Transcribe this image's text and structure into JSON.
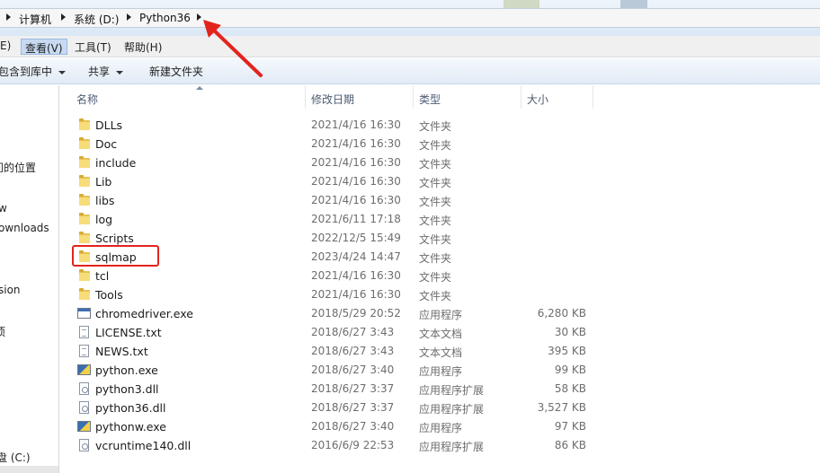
{
  "address_bar": {
    "breadcrumbs": [
      "计算机",
      "系统 (D:)",
      "Python36"
    ]
  },
  "menu": {
    "items": [
      "E)",
      "查看(V)",
      "工具(T)",
      "帮助(H)"
    ],
    "active_index": 1
  },
  "toolbar": {
    "include_library": "包含到库中",
    "share": "共享",
    "new_folder": "新建文件夹"
  },
  "nav": {
    "items": [
      "问的位置",
      "w",
      "ownloads",
      "sion",
      "项",
      "盘 (C:)"
    ]
  },
  "columns": {
    "name": "名称",
    "modified": "修改日期",
    "type": "类型",
    "size": "大小"
  },
  "files": [
    {
      "name": "DLLs",
      "date": "2021/4/16 16:30",
      "type": "文件夹",
      "size": "",
      "icon": "folder-icon"
    },
    {
      "name": "Doc",
      "date": "2021/4/16 16:30",
      "type": "文件夹",
      "size": "",
      "icon": "folder-icon"
    },
    {
      "name": "include",
      "date": "2021/4/16 16:30",
      "type": "文件夹",
      "size": "",
      "icon": "folder-icon"
    },
    {
      "name": "Lib",
      "date": "2021/4/16 16:30",
      "type": "文件夹",
      "size": "",
      "icon": "folder-icon"
    },
    {
      "name": "libs",
      "date": "2021/4/16 16:30",
      "type": "文件夹",
      "size": "",
      "icon": "folder-icon"
    },
    {
      "name": "log",
      "date": "2021/6/11 17:18",
      "type": "文件夹",
      "size": "",
      "icon": "folder-icon"
    },
    {
      "name": "Scripts",
      "date": "2022/12/5 15:49",
      "type": "文件夹",
      "size": "",
      "icon": "folder-icon"
    },
    {
      "name": "sqlmap",
      "date": "2023/4/24 14:47",
      "type": "文件夹",
      "size": "",
      "icon": "folder-icon"
    },
    {
      "name": "tcl",
      "date": "2021/4/16 16:30",
      "type": "文件夹",
      "size": "",
      "icon": "folder-icon"
    },
    {
      "name": "Tools",
      "date": "2021/4/16 16:30",
      "type": "文件夹",
      "size": "",
      "icon": "folder-icon"
    },
    {
      "name": "chromedriver.exe",
      "date": "2018/5/29 20:52",
      "type": "应用程序",
      "size": "6,280 KB",
      "icon": "exe-icon"
    },
    {
      "name": "LICENSE.txt",
      "date": "2018/6/27 3:43",
      "type": "文本文档",
      "size": "30 KB",
      "icon": "text-file-icon"
    },
    {
      "name": "NEWS.txt",
      "date": "2018/6/27 3:43",
      "type": "文本文档",
      "size": "395 KB",
      "icon": "text-file-icon"
    },
    {
      "name": "python.exe",
      "date": "2018/6/27 3:40",
      "type": "应用程序",
      "size": "99 KB",
      "icon": "python-exe-icon"
    },
    {
      "name": "python3.dll",
      "date": "2018/6/27 3:37",
      "type": "应用程序扩展",
      "size": "58 KB",
      "icon": "dll-icon"
    },
    {
      "name": "python36.dll",
      "date": "2018/6/27 3:37",
      "type": "应用程序扩展",
      "size": "3,527 KB",
      "icon": "dll-icon"
    },
    {
      "name": "pythonw.exe",
      "date": "2018/6/27 3:40",
      "type": "应用程序",
      "size": "97 KB",
      "icon": "python-exe-icon"
    },
    {
      "name": "vcruntime140.dll",
      "date": "2016/6/9 22:53",
      "type": "应用程序扩展",
      "size": "86 KB",
      "icon": "dll-icon"
    }
  ],
  "annotations": {
    "highlight_color": "#e3241c"
  }
}
